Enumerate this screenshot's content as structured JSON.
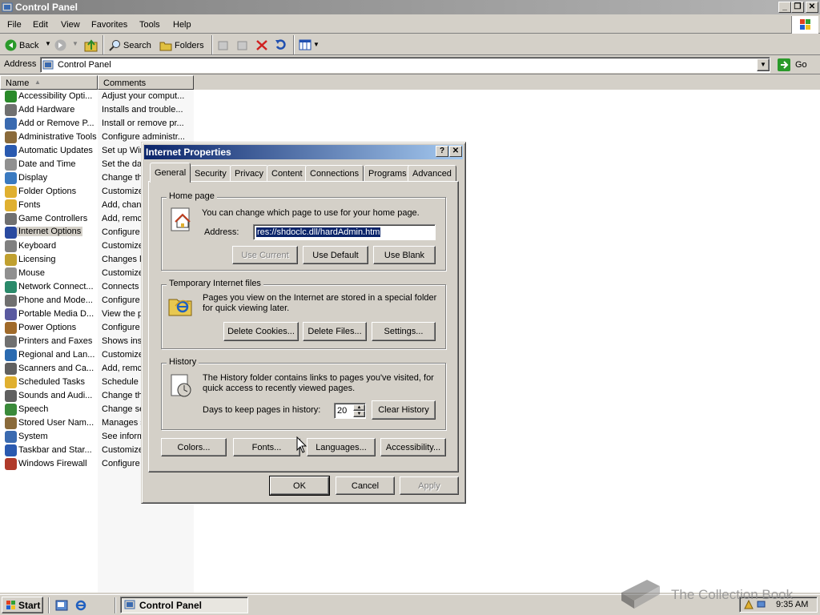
{
  "window": {
    "title": "Control Panel"
  },
  "menu": [
    "File",
    "Edit",
    "View",
    "Favorites",
    "Tools",
    "Help"
  ],
  "toolbar": {
    "back": "Back",
    "search": "Search",
    "folders": "Folders"
  },
  "address": {
    "label": "Address",
    "value": "Control Panel",
    "go": "Go"
  },
  "columns": {
    "name": "Name",
    "comments": "Comments"
  },
  "items": [
    {
      "name": "Accessibility Opti...",
      "comment": "Adjust your comput...",
      "color": "#2a8a2a"
    },
    {
      "name": "Add Hardware",
      "comment": "Installs and trouble...",
      "color": "#707070"
    },
    {
      "name": "Add or Remove P...",
      "comment": "Install or remove pr...",
      "color": "#3a6ab0"
    },
    {
      "name": "Administrative Tools",
      "comment": "Configure administr...",
      "color": "#8a6a3a"
    },
    {
      "name": "Automatic Updates",
      "comment": "Set up Wir",
      "color": "#2a5ab0"
    },
    {
      "name": "Date and Time",
      "comment": "Set the da",
      "color": "#909090"
    },
    {
      "name": "Display",
      "comment": "Change th",
      "color": "#3a7ac0"
    },
    {
      "name": "Folder Options",
      "comment": "Customize",
      "color": "#e0b030"
    },
    {
      "name": "Fonts",
      "comment": "Add, chan",
      "color": "#e0b030"
    },
    {
      "name": "Game Controllers",
      "comment": "Add, remc",
      "color": "#707070"
    },
    {
      "name": "Internet Options",
      "comment": "Configure",
      "color": "#2a4aa0"
    },
    {
      "name": "Keyboard",
      "comment": "Customize",
      "color": "#808080"
    },
    {
      "name": "Licensing",
      "comment": "Changes li",
      "color": "#c0a030"
    },
    {
      "name": "Mouse",
      "comment": "Customize",
      "color": "#909090"
    },
    {
      "name": "Network Connect...",
      "comment": "Connects",
      "color": "#2a8a6a"
    },
    {
      "name": "Phone and Mode...",
      "comment": "Configure",
      "color": "#707070"
    },
    {
      "name": "Portable Media D...",
      "comment": "View the p",
      "color": "#5a5aa0"
    },
    {
      "name": "Power Options",
      "comment": "Configure",
      "color": "#a06a2a"
    },
    {
      "name": "Printers and Faxes",
      "comment": "Shows inst",
      "color": "#707070"
    },
    {
      "name": "Regional and Lan...",
      "comment": "Customize",
      "color": "#2a6ab0"
    },
    {
      "name": "Scanners and Ca...",
      "comment": "Add, remc",
      "color": "#606060"
    },
    {
      "name": "Scheduled Tasks",
      "comment": "Schedule c",
      "color": "#e0b030"
    },
    {
      "name": "Sounds and Audi...",
      "comment": "Change th",
      "color": "#606060"
    },
    {
      "name": "Speech",
      "comment": "Change se",
      "color": "#3a8a3a"
    },
    {
      "name": "Stored User Nam...",
      "comment": "Manages s",
      "color": "#8a6a3a"
    },
    {
      "name": "System",
      "comment": "See inform",
      "color": "#3a6ab0"
    },
    {
      "name": "Taskbar and Star...",
      "comment": "Customize",
      "color": "#2a5ab0"
    },
    {
      "name": "Windows Firewall",
      "comment": "Configure",
      "color": "#b03a2a"
    }
  ],
  "selected_item": "Internet Options",
  "dialog": {
    "title": "Internet Properties",
    "help": "?",
    "tabs": [
      "General",
      "Security",
      "Privacy",
      "Content",
      "Connections",
      "Programs",
      "Advanced"
    ],
    "active_tab": "General",
    "homepage": {
      "legend": "Home page",
      "desc": "You can change which page to use for your home page.",
      "address_label": "Address:",
      "address_value": "res://shdoclc.dll/hardAdmin.htm",
      "use_current": "Use Current",
      "use_default": "Use Default",
      "use_blank": "Use Blank"
    },
    "temp_files": {
      "legend": "Temporary Internet files",
      "desc": "Pages you view on the Internet are stored in a special folder for quick viewing later.",
      "delete_cookies": "Delete Cookies...",
      "delete_files": "Delete Files...",
      "settings": "Settings..."
    },
    "history": {
      "legend": "History",
      "desc": "The History folder contains links to pages you've visited, for quick access to recently viewed pages.",
      "days_label": "Days to keep pages in history:",
      "days_value": "20",
      "clear": "Clear History"
    },
    "bottom": {
      "colors": "Colors...",
      "fonts": "Fonts...",
      "languages": "Languages...",
      "accessibility": "Accessibility..."
    },
    "ok": "OK",
    "cancel": "Cancel",
    "apply": "Apply"
  },
  "taskbar": {
    "start": "Start",
    "task": "Control Panel",
    "clock": "9:35 AM"
  },
  "watermark": "The Collection Book"
}
